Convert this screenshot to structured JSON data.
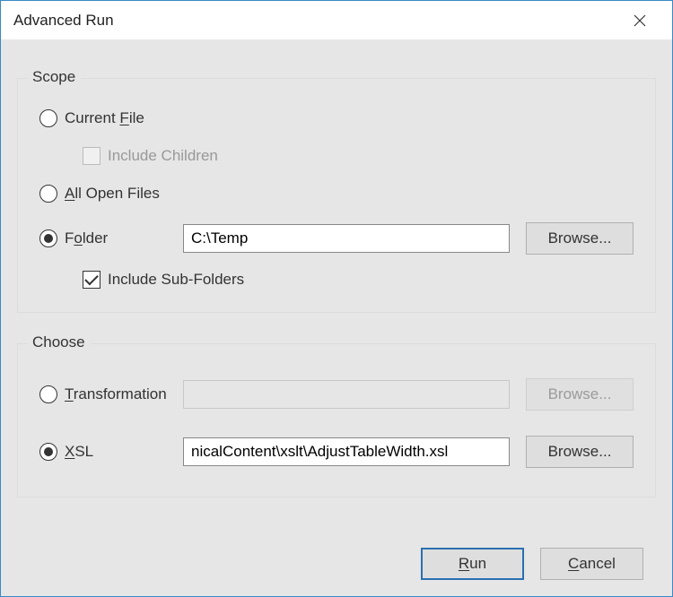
{
  "window": {
    "title": "Advanced Run"
  },
  "scope": {
    "title": "Scope",
    "currentFile": {
      "label_pre": "Current ",
      "label_u": "F",
      "label_post": "ile",
      "checked": false
    },
    "includeChildren": {
      "label": "Include Children",
      "checked": false,
      "disabled": true
    },
    "allOpen": {
      "label_u": "A",
      "label_post": "ll Open Files",
      "checked": false
    },
    "folder": {
      "label_pre": "F",
      "label_u": "o",
      "label_post": "lder",
      "checked": true,
      "path": "C:\\Temp",
      "browse": "Browse..."
    },
    "includeSub": {
      "label": "Include Sub-Folders",
      "checked": true
    }
  },
  "choose": {
    "title": "Choose",
    "transformation": {
      "label_u": "T",
      "label_post": "ransformation",
      "checked": false,
      "value": "",
      "browse": "Browse...",
      "disabled": true
    },
    "xsl": {
      "label_u": "X",
      "label_post": "SL",
      "checked": true,
      "value": "nicalContent\\xslt\\AdjustTableWidth.xsl",
      "browse": "Browse..."
    }
  },
  "footer": {
    "run_u": "R",
    "run_post": "un",
    "cancel_u": "C",
    "cancel_post": "ancel"
  }
}
